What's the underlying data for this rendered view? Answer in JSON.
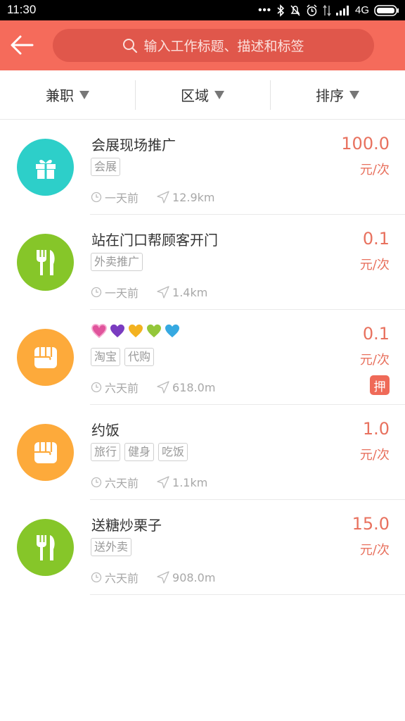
{
  "status_bar": {
    "time": "11:30",
    "network": "4G"
  },
  "header": {
    "search_placeholder": "输入工作标题、描述和标签"
  },
  "filters": [
    {
      "label": "兼职"
    },
    {
      "label": "区域"
    },
    {
      "label": "排序"
    }
  ],
  "jobs": [
    {
      "title": "会展现场推广",
      "tags": [
        "会展"
      ],
      "time": "一天前",
      "distance": "12.9km",
      "price": "100.0",
      "unit": "元/次",
      "icon": "gift-icon",
      "color": "#2dcfc9"
    },
    {
      "title": "站在门口帮顾客开门",
      "tags": [
        "外卖推广"
      ],
      "time": "一天前",
      "distance": "1.4km",
      "price": "0.1",
      "unit": "元/次",
      "icon": "fork-knife-icon",
      "color": "#86c629"
    },
    {
      "title": "",
      "tags": [
        "淘宝",
        "代购"
      ],
      "time": "六天前",
      "distance": "618.0m",
      "price": "0.1",
      "unit": "元/次",
      "badge": "押",
      "icon": "fist-icon",
      "color": "#fdaa3b",
      "heart_colors": [
        "#e0549c",
        "#7a3cc0",
        "#f3b220",
        "#94c73a",
        "#36a9e1"
      ]
    },
    {
      "title": "约饭",
      "tags": [
        "旅行",
        "健身",
        "吃饭"
      ],
      "time": "六天前",
      "distance": "1.1km",
      "price": "1.0",
      "unit": "元/次",
      "icon": "fist-icon",
      "color": "#fdaa3b"
    },
    {
      "title": "送糖炒栗子",
      "tags": [
        "送外卖"
      ],
      "time": "六天前",
      "distance": "908.0m",
      "price": "15.0",
      "unit": "元/次",
      "icon": "fork-knife-icon",
      "color": "#86c629"
    }
  ]
}
